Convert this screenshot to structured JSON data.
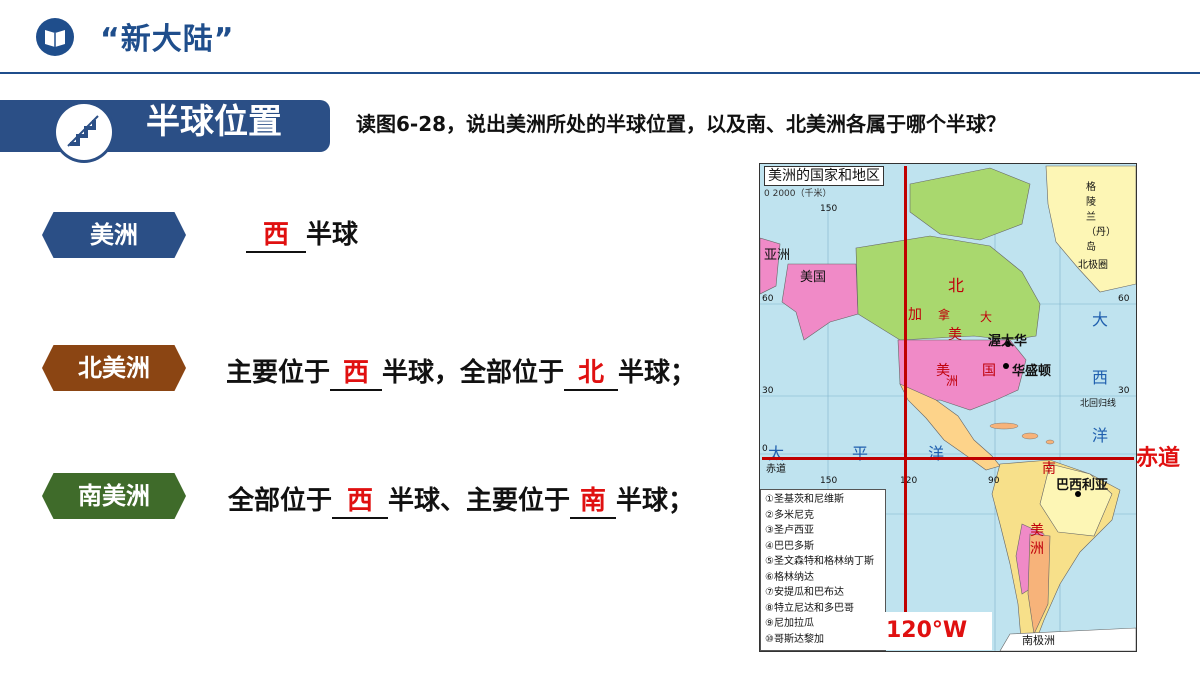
{
  "header": {
    "title": "“新大陆”"
  },
  "section": {
    "title": "半球位置",
    "question": "读图6-28，说出美洲所处的半球位置，以及南、北美洲各属于哪个半球？"
  },
  "rows": {
    "america": {
      "tag": "美洲",
      "answer": "西",
      "suffix": "半球"
    },
    "north": {
      "tag": "北美洲",
      "prefix": "主要位于",
      "answer1": "西",
      "mid": "半球，全部位于",
      "answer2": "北",
      "suffix": "半球；"
    },
    "south": {
      "tag": "南美洲",
      "prefix": "全部位于",
      "answer1": "西",
      "mid": "半球、主要位于",
      "answer2": "南",
      "suffix": "半球；"
    }
  },
  "map": {
    "title": "美洲的国家和地区",
    "scale": "0      2000（千米）",
    "equator_label": "赤道",
    "meridian_label": "120°W",
    "labels": {
      "greenland": "格陵兰（丹）岛",
      "canada1": "北",
      "canada2": "加",
      "canada3": "拿",
      "canada4": "大",
      "usa1": "美",
      "usa2": "国",
      "am_n": "美",
      "am_s": "洲",
      "ottawa": "渥太华",
      "washington": "华盛顿",
      "atlantic1": "大",
      "atlantic2": "西",
      "atlantic3": "洋",
      "pacific1": "太",
      "pacific2": "平",
      "pacific3": "洋",
      "brasilia": "巴西利亚",
      "south1": "南",
      "south2": "美",
      "south3": "洲",
      "arctic": "北极圈",
      "cancer": "北回归线",
      "equator_small": "赤道",
      "antarctic": "南极洲",
      "asia": "亚洲",
      "usa_alaska": "美国"
    },
    "grid": [
      "150",
      "60",
      "30",
      "0",
      "150",
      "120",
      "90",
      "60",
      "30"
    ],
    "legend": [
      "①圣基茨和尼维斯",
      "②多米尼克",
      "③圣卢西亚",
      "④巴巴多斯",
      "⑤圣文森特和格林纳丁斯",
      "⑥格林纳达",
      "⑦安提瓜和巴布达",
      "⑧特立尼达和多巴哥",
      "⑨尼加拉瓜",
      "⑩哥斯达黎加"
    ]
  }
}
